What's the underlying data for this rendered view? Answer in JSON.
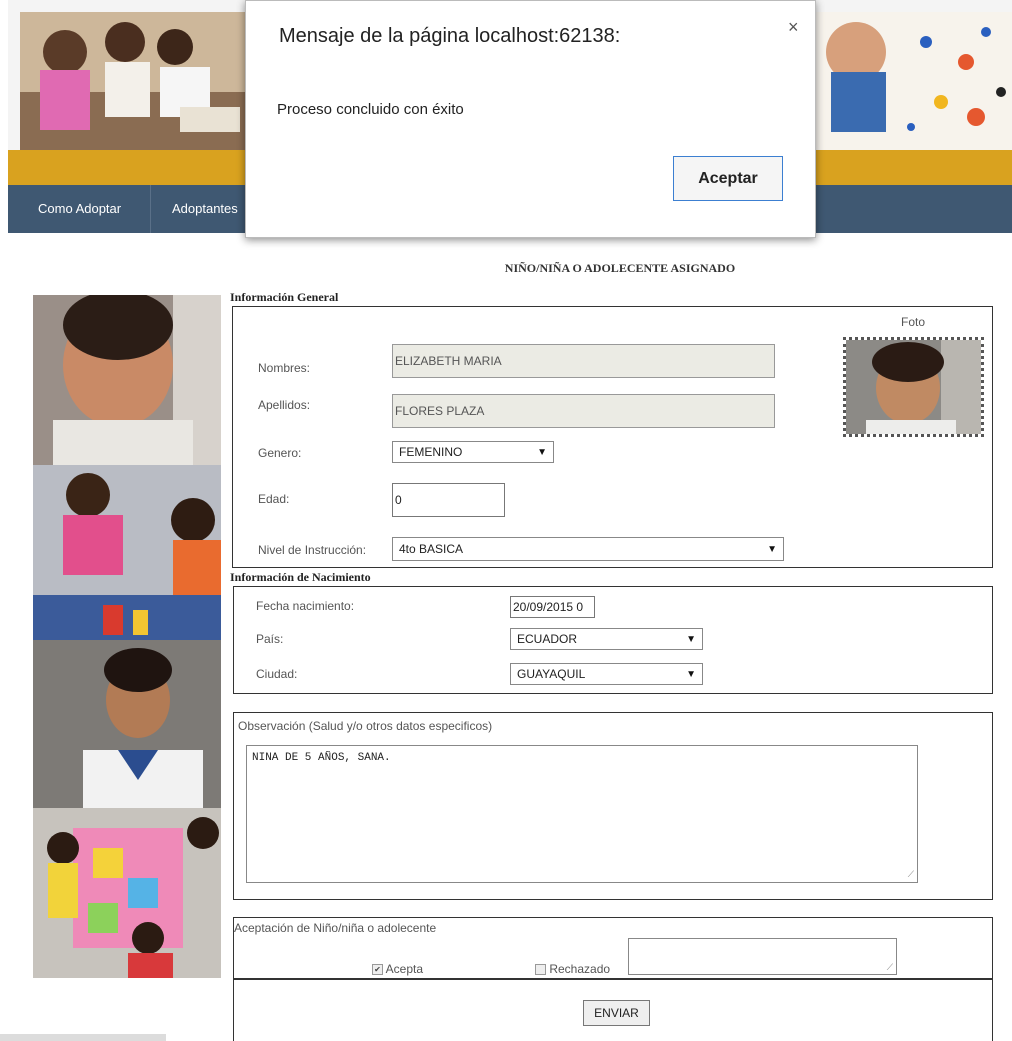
{
  "nav": {
    "items": [
      "Como Adoptar",
      "Adoptantes"
    ]
  },
  "dialog": {
    "title": "Mensaje de la página localhost:62138:",
    "close_glyph": "×",
    "message": "Proceso concluido con éxito",
    "ok_label": "Aceptar"
  },
  "form": {
    "title": "NIÑO/NIÑA O ADOLECENTE ASIGNADO",
    "general": {
      "legend": "Información General",
      "photo_label": "Foto",
      "nombres_label": "Nombres:",
      "nombres_value": "ELIZABETH MARIA",
      "apellidos_label": "Apellidos:",
      "apellidos_value": "FLORES PLAZA",
      "genero_label": "Genero:",
      "genero_value": "FEMENINO",
      "edad_label": "Edad:",
      "edad_value": "0",
      "nivel_label": "Nivel de Instrucción:",
      "nivel_value": "4to BASICA"
    },
    "nacimiento": {
      "legend": "Información de Nacimiento",
      "fecha_label": "Fecha nacimiento:",
      "fecha_value": "20/09/2015 0",
      "pais_label": "País:",
      "pais_value": "ECUADOR",
      "ciudad_label": "Ciudad:",
      "ciudad_value": "GUAYAQUIL"
    },
    "observacion": {
      "label": "Observación (Salud y/o otros datos especificos)",
      "value": "NINA DE 5 AÑOS, SANA."
    },
    "aceptacion": {
      "label": "Aceptación de Niño/niña o adolecente",
      "acepta_label": "Acepta",
      "acepta_checked": true,
      "rechazado_label": "Rechazado",
      "rechazado_checked": false
    },
    "submit_label": "ENVIAR"
  },
  "icons": {
    "dropdown": "dropdown-arrow-icon",
    "close": "close-icon",
    "checkbox": "checkbox-icon"
  },
  "colors": {
    "nav_bg": "#3f5872",
    "gold_band": "#d9a21f",
    "dialog_button_border": "#3c7fd1"
  }
}
